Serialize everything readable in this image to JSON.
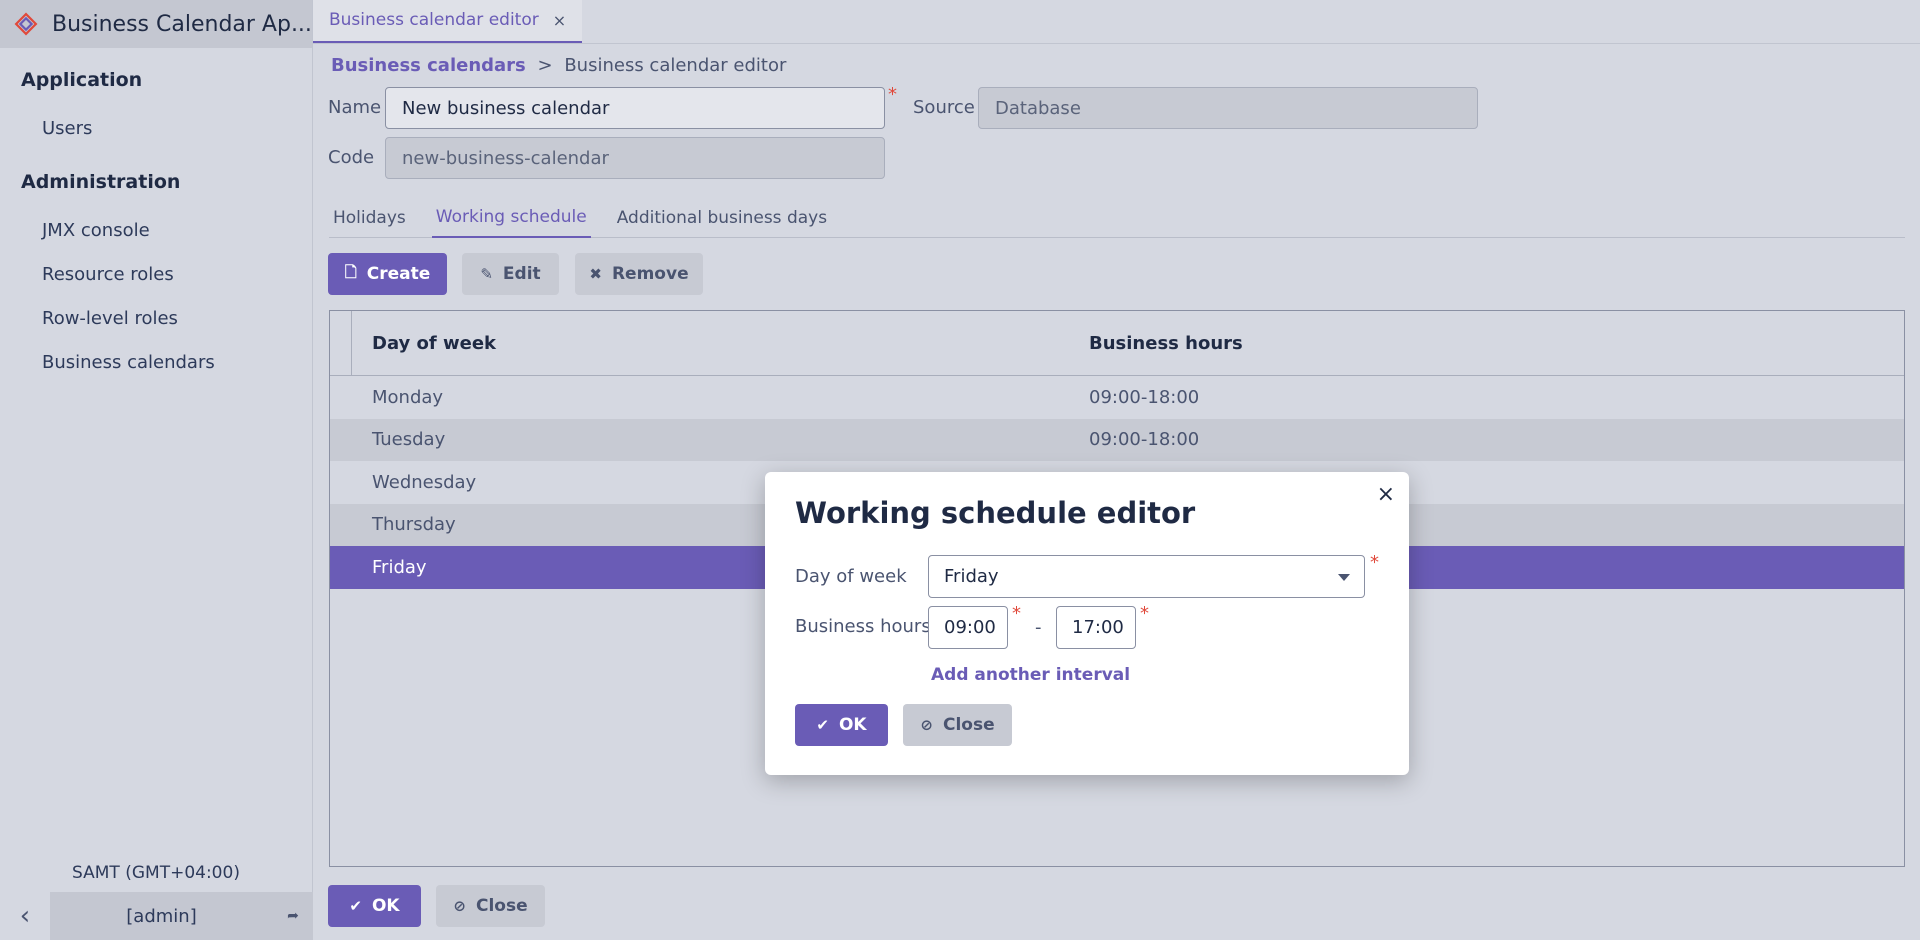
{
  "app": {
    "title": "Business Calendar Ap..."
  },
  "sidebar": {
    "groups": [
      {
        "label": "Application",
        "items": [
          "Users"
        ]
      },
      {
        "label": "Administration",
        "items": [
          "JMX console",
          "Resource roles",
          "Row-level roles",
          "Business calendars"
        ]
      }
    ],
    "timezone": "SAMT (GMT+04:00)",
    "user": "[admin]"
  },
  "tabs": {
    "active": "Business calendar editor",
    "close": "×"
  },
  "breadcrumb": {
    "parent": "Business calendars",
    "separator": ">",
    "current": "Business calendar editor"
  },
  "form": {
    "name_label": "Name",
    "name_value": "New business calendar",
    "source_label": "Source",
    "source_value": "Database",
    "code_label": "Code",
    "code_value": "new-business-calendar",
    "required_mark": "*"
  },
  "subtabs": [
    "Holidays",
    "Working schedule",
    "Additional business days"
  ],
  "toolbar": {
    "create": "Create",
    "edit": "Edit",
    "remove": "Remove"
  },
  "table": {
    "columns": [
      "Day of week",
      "Business hours"
    ],
    "rows": [
      {
        "day": "Monday",
        "hours": "09:00-18:00"
      },
      {
        "day": "Tuesday",
        "hours": "09:00-18:00"
      },
      {
        "day": "Wednesday",
        "hours": ""
      },
      {
        "day": "Thursday",
        "hours": ""
      },
      {
        "day": "Friday",
        "hours": ""
      }
    ]
  },
  "footer": {
    "ok": "OK",
    "close": "Close"
  },
  "dialog": {
    "title": "Working schedule editor",
    "close_icon": "×",
    "day_label": "Day of week",
    "day_value": "Friday",
    "hours_label": "Business hours",
    "from": "09:00",
    "dash": "-",
    "to": "17:00",
    "add_interval": "Add another interval",
    "ok": "OK",
    "close": "Close"
  }
}
